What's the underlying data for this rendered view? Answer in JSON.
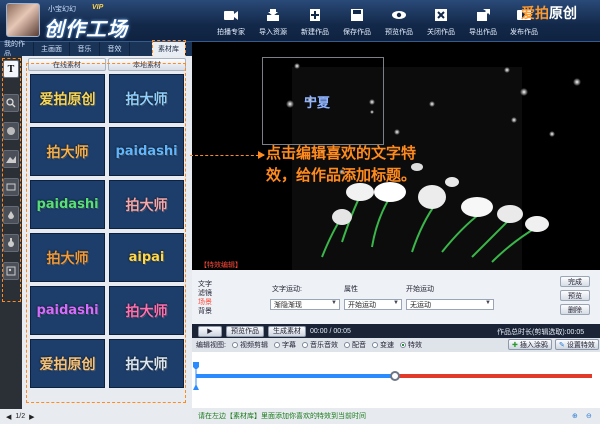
{
  "header": {
    "username": "小宝幻幻",
    "vip": "VIP",
    "app_title": "创作工场",
    "toolbar": [
      {
        "label": "拍播专家",
        "icon": "camera-icon"
      },
      {
        "label": "导入资源",
        "icon": "import-icon"
      },
      {
        "label": "新建作品",
        "icon": "new-icon"
      },
      {
        "label": "保存作品",
        "icon": "save-icon"
      },
      {
        "label": "预览作品",
        "icon": "eye-icon"
      },
      {
        "label": "关闭作品",
        "icon": "close-icon"
      },
      {
        "label": "导出作品",
        "icon": "export-icon"
      },
      {
        "label": "发布作品",
        "icon": "publish-icon"
      }
    ],
    "brand_a": "爱拍",
    "brand_b": "原创"
  },
  "left": {
    "tabs": [
      "我的作品",
      "主画面",
      "音乐",
      "音效",
      "素材库"
    ],
    "side_active": "T",
    "subtabs": [
      "在线素材",
      "本地素材"
    ],
    "tiles": [
      {
        "text": "爱拍原创",
        "color": "#f6d65a"
      },
      {
        "text": "拍大师",
        "color": "#8fd0ff"
      },
      {
        "text": "拍大师",
        "color": "#f6b04a"
      },
      {
        "text": "paidashi",
        "color": "#5fb6ff"
      },
      {
        "text": "paidashi",
        "color": "#56e07a"
      },
      {
        "text": "拍大师",
        "color": "#f3a7ad"
      },
      {
        "text": "拍大师",
        "color": "#f09b3a"
      },
      {
        "text": "aipai",
        "color": "#ffd84a"
      },
      {
        "text": "paidashi",
        "color": "#d36cff"
      },
      {
        "text": "拍大师",
        "color": "#ff6fb1"
      },
      {
        "text": "爱拍原创",
        "color": "#f7c27a"
      },
      {
        "text": "拍大师",
        "color": "#d9e6f2"
      }
    ],
    "pager": "1/2"
  },
  "preview": {
    "stage_text": "宁夏",
    "callout_line1": "点击编辑喜欢的文字特",
    "callout_line2": "效，给作品添加标题。",
    "effects_label": "【特效编辑】"
  },
  "edit": {
    "side_items": [
      "文字",
      "滤镜",
      "场景",
      "背景"
    ],
    "text_motion_label": "文字运动:",
    "attr_label": "属性",
    "start_motion_label": "开始运动",
    "text_motion_value": "渐隐渐现",
    "attr_value": "开始运动",
    "start_motion_value": "无运动",
    "buttons": [
      "完成",
      "预览",
      "删除"
    ]
  },
  "controls": {
    "play": "▶",
    "preview_btn": "预览作品",
    "generate_btn": "生成素材",
    "time": "00:00 / 00:05",
    "total": "作品总时长(剪辑选取):00:05"
  },
  "timeline": {
    "view_label": "编辑视图:",
    "modes": [
      "视频剪辑",
      "字幕",
      "音乐音效",
      "配音",
      "变速",
      "特效"
    ],
    "active_mode": "特效",
    "insert_btn": "插入涂鸦",
    "settings_btn": "设置特效"
  },
  "status": "请在左边【素材库】里面添加你喜欢的特效到当前时间",
  "colors": {
    "accent": "#ff8a1e",
    "header": "#13294a",
    "track_blue": "#2a8bff",
    "track_red": "#e23a2a"
  }
}
